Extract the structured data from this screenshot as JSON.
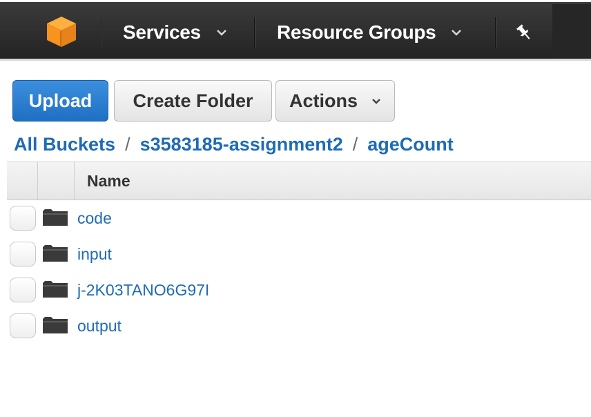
{
  "nav": {
    "logo_icon": "aws-cube-icon",
    "services_label": "Services",
    "resource_groups_label": "Resource Groups",
    "pin_icon": "pushpin-icon"
  },
  "toolbar": {
    "upload_label": "Upload",
    "create_folder_label": "Create Folder",
    "actions_label": "Actions"
  },
  "breadcrumb": {
    "items": [
      "All Buckets",
      "s3583185-assignment2",
      "ageCount"
    ],
    "separator": "/"
  },
  "table": {
    "name_header": "Name",
    "rows": [
      {
        "name": "code",
        "type": "folder"
      },
      {
        "name": "input",
        "type": "folder"
      },
      {
        "name": "j-2K03TANO6G97I",
        "type": "folder"
      },
      {
        "name": "output",
        "type": "folder"
      }
    ]
  },
  "colors": {
    "nav_bg": "#2b2b2b",
    "logo_orange": "#f7931e",
    "primary_blue": "#2a7fd4",
    "link_blue": "#1f6bb5"
  }
}
